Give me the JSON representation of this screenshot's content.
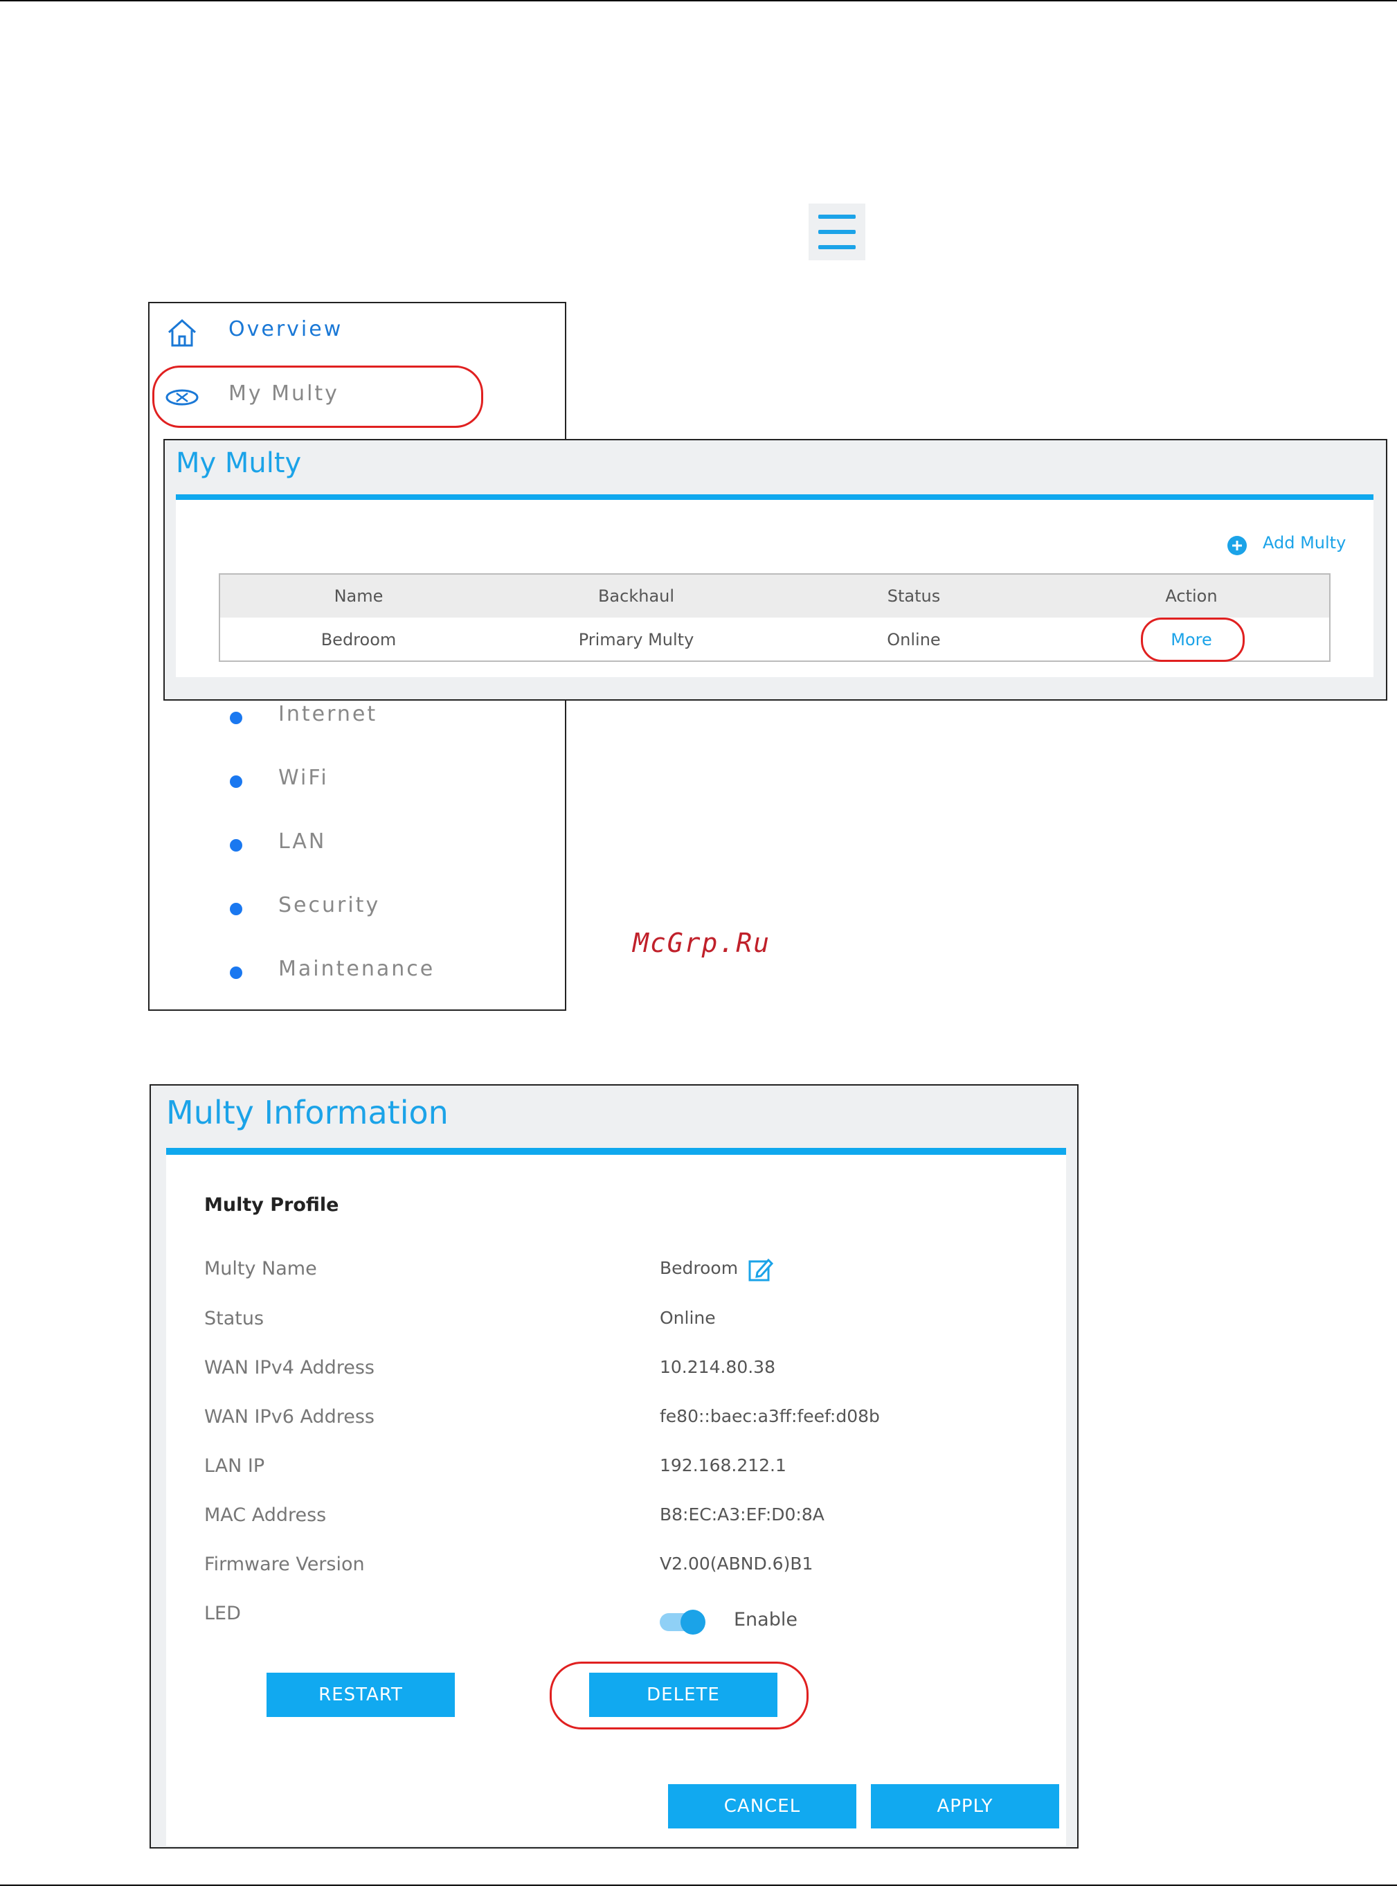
{
  "sidebar": {
    "overview": "Overview",
    "my_multy": "My Multy",
    "items": [
      "Internet",
      "WiFi",
      "LAN",
      "Security",
      "Maintenance"
    ]
  },
  "my_multy_panel": {
    "title": "My Multy",
    "add_label": "Add Multy",
    "columns": [
      "Name",
      "Backhaul",
      "Status",
      "Action"
    ],
    "rows": [
      {
        "name": "Bedroom",
        "backhaul": "Primary Multy",
        "status": "Online",
        "action": "More"
      }
    ]
  },
  "watermark": "McGrp.Ru",
  "multy_info": {
    "title": "Multy Information",
    "section": "Multy Profile",
    "fields": [
      {
        "label": "Multy Name",
        "value": "Bedroom"
      },
      {
        "label": "Status",
        "value": "Online"
      },
      {
        "label": "WAN IPv4 Address",
        "value": "10.214.80.38"
      },
      {
        "label": "WAN IPv6 Address",
        "value": "fe80::baec:a3ff:feef:d08b"
      },
      {
        "label": "LAN IP",
        "value": "192.168.212.1"
      },
      {
        "label": "MAC Address",
        "value": "B8:EC:A3:EF:D0:8A"
      },
      {
        "label": "Firmware Version",
        "value": "V2.00(ABND.6)B1"
      }
    ],
    "led_label": "LED",
    "led_value": "Enable",
    "restart": "RESTART",
    "delete": "DELETE",
    "cancel": "CANCEL",
    "apply": "APPLY"
  },
  "colors": {
    "accent": "#1ba3e8",
    "highlight": "#e02020"
  }
}
